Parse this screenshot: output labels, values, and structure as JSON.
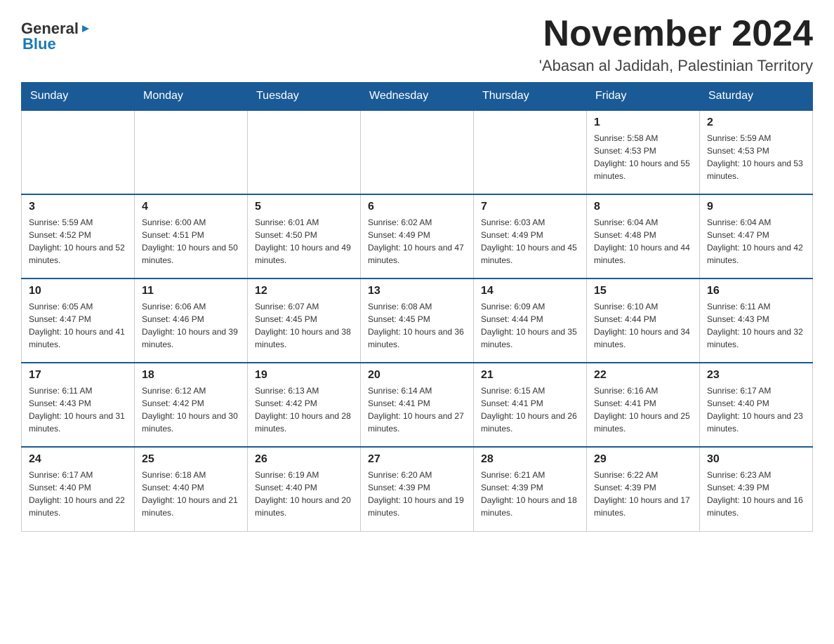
{
  "header": {
    "logo_text_general": "General",
    "logo_text_blue": "Blue",
    "month_title": "November 2024",
    "location": "'Abasan al Jadidah, Palestinian Territory"
  },
  "days_of_week": [
    "Sunday",
    "Monday",
    "Tuesday",
    "Wednesday",
    "Thursday",
    "Friday",
    "Saturday"
  ],
  "weeks": [
    {
      "days": [
        {
          "number": "",
          "info": ""
        },
        {
          "number": "",
          "info": ""
        },
        {
          "number": "",
          "info": ""
        },
        {
          "number": "",
          "info": ""
        },
        {
          "number": "",
          "info": ""
        },
        {
          "number": "1",
          "info": "Sunrise: 5:58 AM\nSunset: 4:53 PM\nDaylight: 10 hours and 55 minutes."
        },
        {
          "number": "2",
          "info": "Sunrise: 5:59 AM\nSunset: 4:53 PM\nDaylight: 10 hours and 53 minutes."
        }
      ]
    },
    {
      "days": [
        {
          "number": "3",
          "info": "Sunrise: 5:59 AM\nSunset: 4:52 PM\nDaylight: 10 hours and 52 minutes."
        },
        {
          "number": "4",
          "info": "Sunrise: 6:00 AM\nSunset: 4:51 PM\nDaylight: 10 hours and 50 minutes."
        },
        {
          "number": "5",
          "info": "Sunrise: 6:01 AM\nSunset: 4:50 PM\nDaylight: 10 hours and 49 minutes."
        },
        {
          "number": "6",
          "info": "Sunrise: 6:02 AM\nSunset: 4:49 PM\nDaylight: 10 hours and 47 minutes."
        },
        {
          "number": "7",
          "info": "Sunrise: 6:03 AM\nSunset: 4:49 PM\nDaylight: 10 hours and 45 minutes."
        },
        {
          "number": "8",
          "info": "Sunrise: 6:04 AM\nSunset: 4:48 PM\nDaylight: 10 hours and 44 minutes."
        },
        {
          "number": "9",
          "info": "Sunrise: 6:04 AM\nSunset: 4:47 PM\nDaylight: 10 hours and 42 minutes."
        }
      ]
    },
    {
      "days": [
        {
          "number": "10",
          "info": "Sunrise: 6:05 AM\nSunset: 4:47 PM\nDaylight: 10 hours and 41 minutes."
        },
        {
          "number": "11",
          "info": "Sunrise: 6:06 AM\nSunset: 4:46 PM\nDaylight: 10 hours and 39 minutes."
        },
        {
          "number": "12",
          "info": "Sunrise: 6:07 AM\nSunset: 4:45 PM\nDaylight: 10 hours and 38 minutes."
        },
        {
          "number": "13",
          "info": "Sunrise: 6:08 AM\nSunset: 4:45 PM\nDaylight: 10 hours and 36 minutes."
        },
        {
          "number": "14",
          "info": "Sunrise: 6:09 AM\nSunset: 4:44 PM\nDaylight: 10 hours and 35 minutes."
        },
        {
          "number": "15",
          "info": "Sunrise: 6:10 AM\nSunset: 4:44 PM\nDaylight: 10 hours and 34 minutes."
        },
        {
          "number": "16",
          "info": "Sunrise: 6:11 AM\nSunset: 4:43 PM\nDaylight: 10 hours and 32 minutes."
        }
      ]
    },
    {
      "days": [
        {
          "number": "17",
          "info": "Sunrise: 6:11 AM\nSunset: 4:43 PM\nDaylight: 10 hours and 31 minutes."
        },
        {
          "number": "18",
          "info": "Sunrise: 6:12 AM\nSunset: 4:42 PM\nDaylight: 10 hours and 30 minutes."
        },
        {
          "number": "19",
          "info": "Sunrise: 6:13 AM\nSunset: 4:42 PM\nDaylight: 10 hours and 28 minutes."
        },
        {
          "number": "20",
          "info": "Sunrise: 6:14 AM\nSunset: 4:41 PM\nDaylight: 10 hours and 27 minutes."
        },
        {
          "number": "21",
          "info": "Sunrise: 6:15 AM\nSunset: 4:41 PM\nDaylight: 10 hours and 26 minutes."
        },
        {
          "number": "22",
          "info": "Sunrise: 6:16 AM\nSunset: 4:41 PM\nDaylight: 10 hours and 25 minutes."
        },
        {
          "number": "23",
          "info": "Sunrise: 6:17 AM\nSunset: 4:40 PM\nDaylight: 10 hours and 23 minutes."
        }
      ]
    },
    {
      "days": [
        {
          "number": "24",
          "info": "Sunrise: 6:17 AM\nSunset: 4:40 PM\nDaylight: 10 hours and 22 minutes."
        },
        {
          "number": "25",
          "info": "Sunrise: 6:18 AM\nSunset: 4:40 PM\nDaylight: 10 hours and 21 minutes."
        },
        {
          "number": "26",
          "info": "Sunrise: 6:19 AM\nSunset: 4:40 PM\nDaylight: 10 hours and 20 minutes."
        },
        {
          "number": "27",
          "info": "Sunrise: 6:20 AM\nSunset: 4:39 PM\nDaylight: 10 hours and 19 minutes."
        },
        {
          "number": "28",
          "info": "Sunrise: 6:21 AM\nSunset: 4:39 PM\nDaylight: 10 hours and 18 minutes."
        },
        {
          "number": "29",
          "info": "Sunrise: 6:22 AM\nSunset: 4:39 PM\nDaylight: 10 hours and 17 minutes."
        },
        {
          "number": "30",
          "info": "Sunrise: 6:23 AM\nSunset: 4:39 PM\nDaylight: 10 hours and 16 minutes."
        }
      ]
    }
  ]
}
